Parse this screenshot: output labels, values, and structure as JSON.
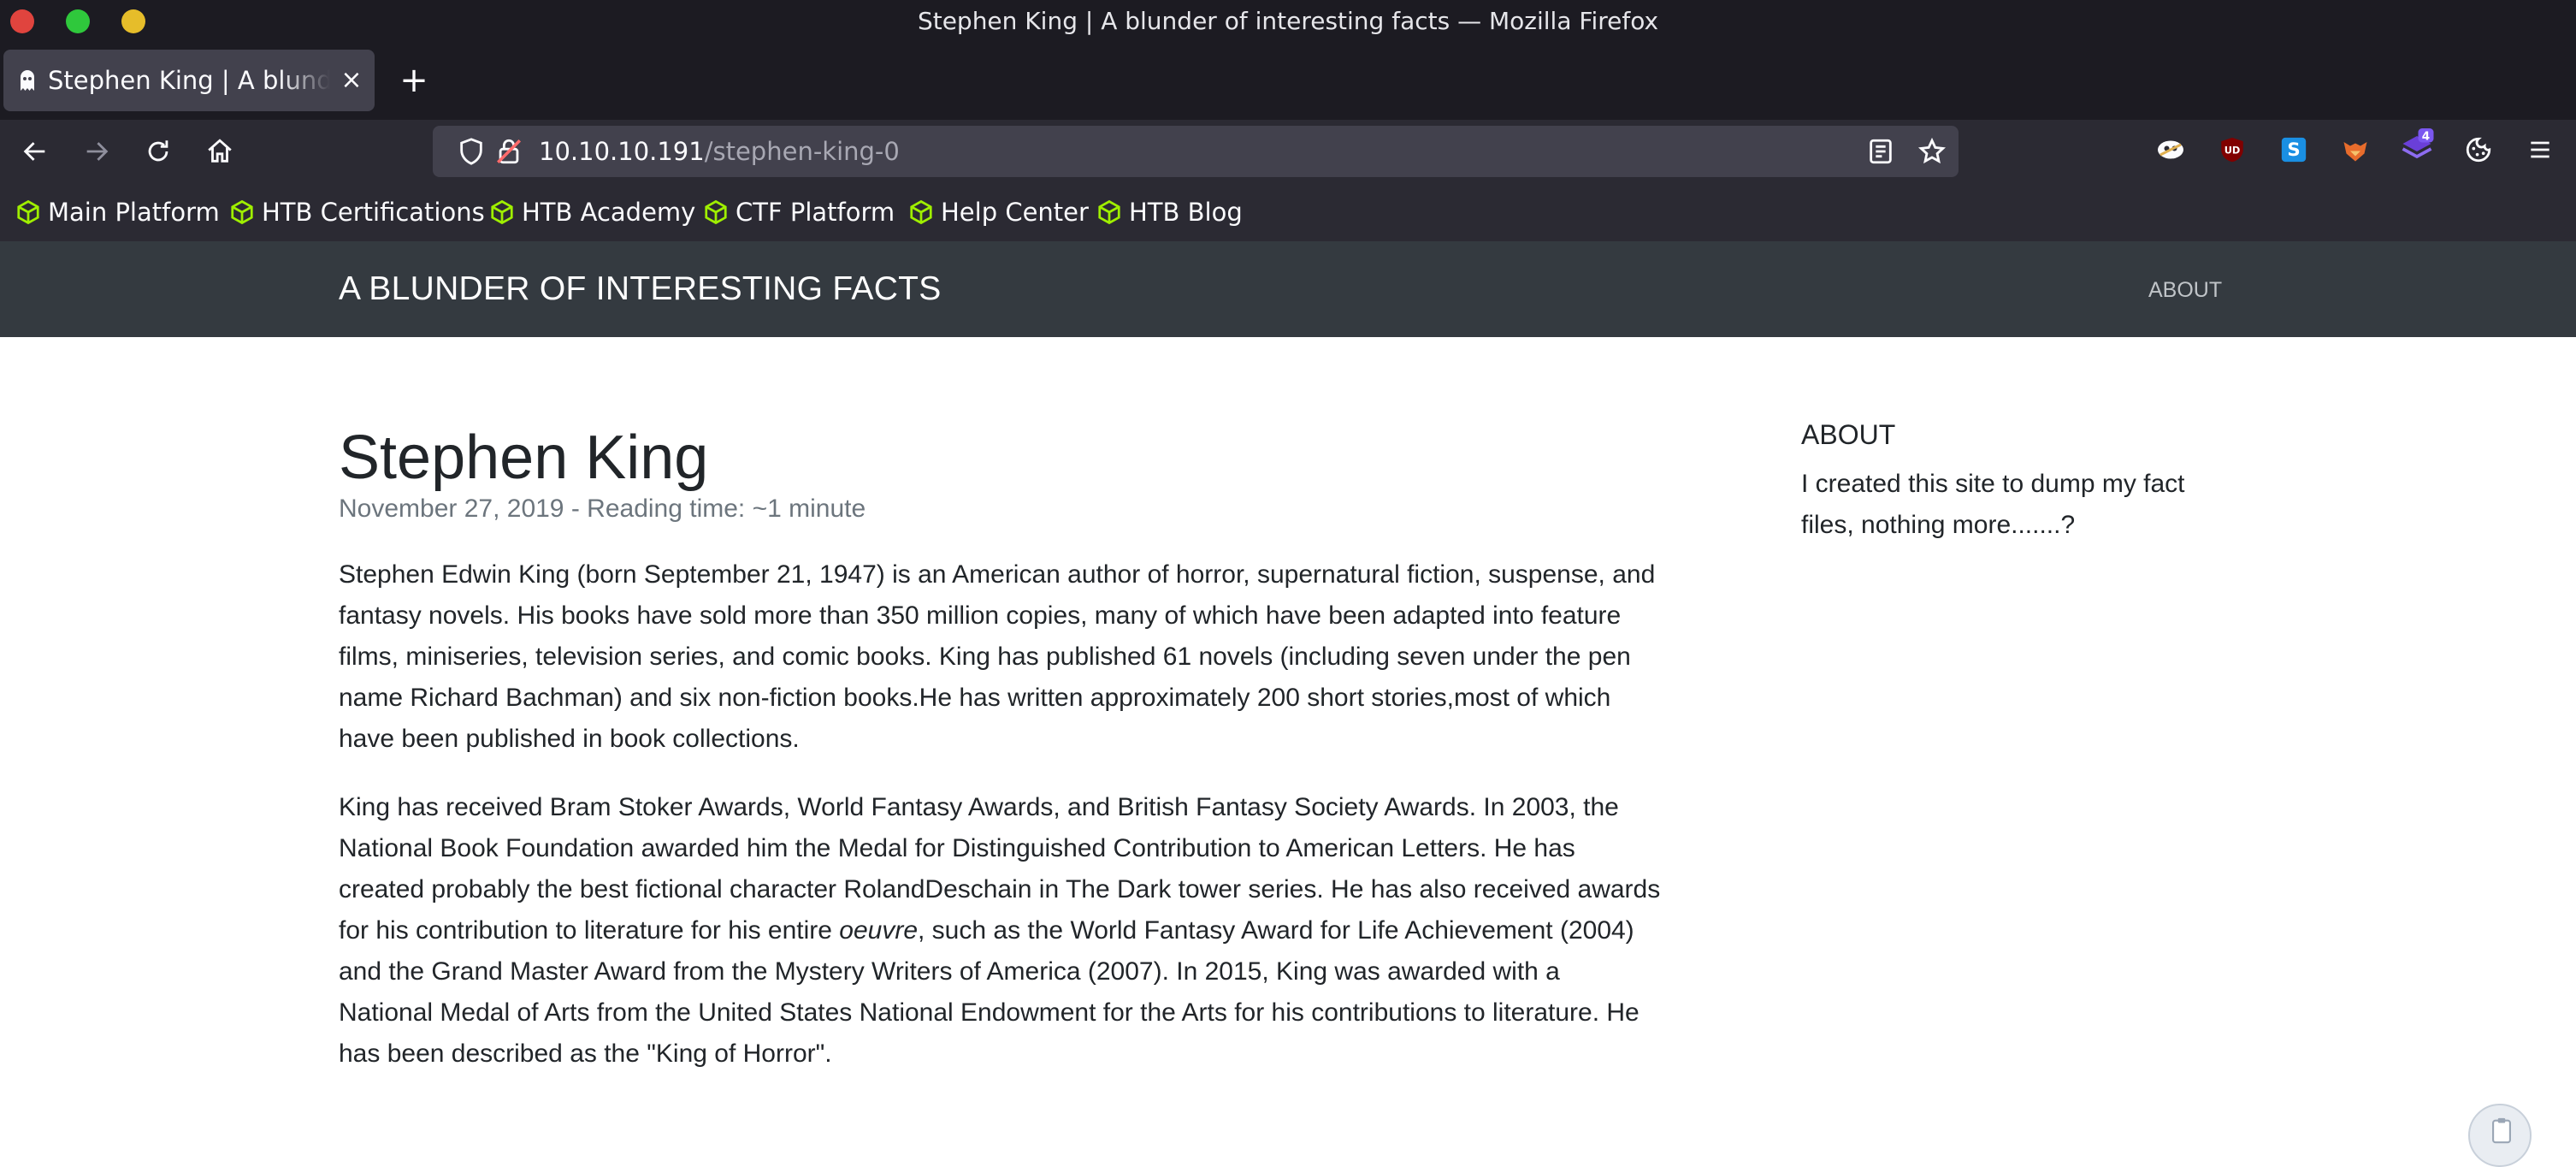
{
  "window": {
    "title": "Stephen King | A blunder of interesting facts — Mozilla Firefox"
  },
  "tab": {
    "title": "Stephen King | A blunder of interesting facts",
    "favicon": "ghost-icon",
    "close_icon": "close-icon"
  },
  "toolbar": {
    "back_icon": "back-arrow-icon",
    "forward_icon": "forward-arrow-icon",
    "reload_icon": "reload-icon",
    "home_icon": "home-icon",
    "url_host": "10.10.10.191",
    "url_path": "/stephen-king-0",
    "reader_icon": "reader-view-icon",
    "bookmark_icon": "star-icon",
    "extensions": [
      {
        "name": "ghost-extension-icon"
      },
      {
        "name": "ublock-icon",
        "label": "UD",
        "color": "#800000"
      },
      {
        "name": "s-extension-icon",
        "label": "S",
        "color": "#1a8fe3"
      },
      {
        "name": "fox-extension-icon",
        "color": "#e86c2c"
      },
      {
        "name": "stack-extension-icon",
        "badge": "4",
        "color": "#6a3fd8"
      },
      {
        "name": "cookie-icon"
      },
      {
        "name": "menu-icon"
      }
    ]
  },
  "bookmarks": [
    {
      "label": "Main Platform"
    },
    {
      "label": "HTB Certifications"
    },
    {
      "label": "HTB Academy"
    },
    {
      "label": "CTF Platform"
    },
    {
      "label": "Help Center"
    },
    {
      "label": "HTB Blog"
    }
  ],
  "site": {
    "brand": "A BLUNDER OF INTERESTING FACTS",
    "nav_about": "ABOUT"
  },
  "post": {
    "title": "Stephen King",
    "meta": "November 27, 2019 - Reading time: ~1 minute",
    "paragraph1_lines": [
      "Stephen Edwin King (born September 21, 1947) is an American author of horror, supernatural fiction, suspense, and",
      "fantasy novels. His books have sold more than 350 million copies, many of which have been adapted into feature",
      "films, miniseries, television series, and comic books. King has published 61 novels (including seven under the pen",
      "name Richard Bachman) and six non-fiction books.He has written approximately 200 short stories,most of which",
      "have been published in book collections."
    ],
    "paragraph2": {
      "line1": "King has received Bram Stoker Awards, World Fantasy Awards, and British Fantasy Society Awards. In 2003, the",
      "line2": "National Book Foundation awarded him the Medal for Distinguished Contribution to American Letters. He has",
      "line3": "created probably the best fictional character RolandDeschain in The Dark tower series. He has also received awards",
      "line4_before": "for his contribution to literature for his entire ",
      "line4_em": "oeuvre",
      "line4_after": ", such as the World Fantasy Award for Life Achievement (2004)",
      "line5": "and the Grand Master Award from the Mystery Writers of America (2007). In 2015, King was awarded with a",
      "line6": "National Medal of Arts from the United States National Endowment for the Arts for his contributions to literature. He",
      "line7": "has been described as the \"King of Horror\"."
    }
  },
  "sidebar": {
    "heading": "ABOUT",
    "text_lines": [
      "I created this site to dump my fact",
      "files, nothing more.......?"
    ]
  },
  "colors": {
    "chrome_dark": "#1c1b22",
    "toolbar": "#2b2a33",
    "urlbar": "#42414d",
    "site_header": "#343a40",
    "bookmark_icon": "#9fef00"
  }
}
